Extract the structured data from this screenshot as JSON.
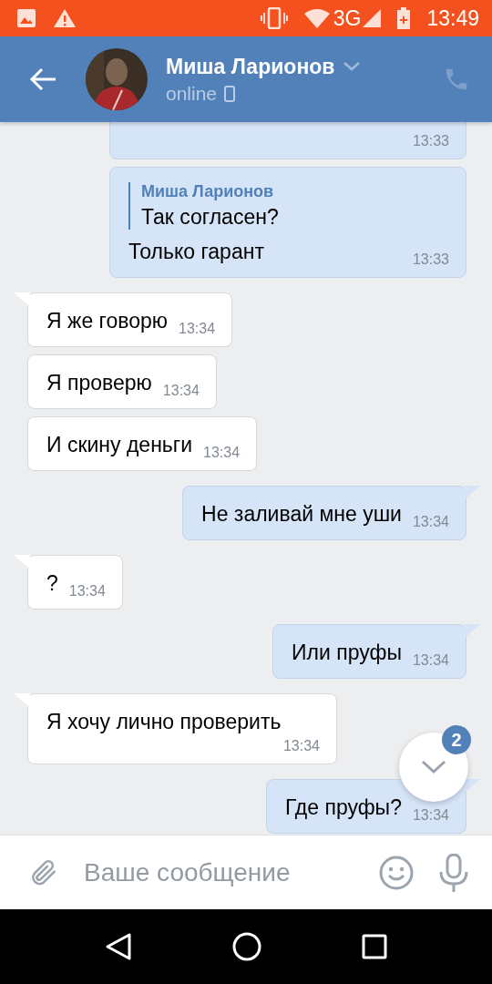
{
  "status_bar": {
    "network": "3G",
    "time": "13:49"
  },
  "header": {
    "name": "Миша Ларионов",
    "status": "online"
  },
  "messages": [
    {
      "outgoing": true,
      "tail": false,
      "time": "13:33"
    },
    {
      "outgoing": true,
      "tail": false,
      "quote": {
        "author": "Миша Ларионов",
        "text": "Так согласен?"
      },
      "text": "Только гарант",
      "time": "13:33"
    },
    {
      "outgoing": false,
      "tail": true,
      "text": "Я же говорю",
      "time": "13:34"
    },
    {
      "outgoing": false,
      "tail": false,
      "text": "Я проверю",
      "time": "13:34"
    },
    {
      "outgoing": false,
      "tail": false,
      "text": "И скину деньги",
      "time": "13:34"
    },
    {
      "outgoing": true,
      "tail": true,
      "text": "Не заливай мне уши",
      "time": "13:34"
    },
    {
      "outgoing": false,
      "tail": true,
      "text": "?",
      "time": "13:34"
    },
    {
      "outgoing": true,
      "tail": true,
      "text": "Или пруфы",
      "time": "13:34"
    },
    {
      "outgoing": false,
      "tail": true,
      "text": "Я хочу лично проверить",
      "time": "13:34"
    },
    {
      "outgoing": true,
      "tail": true,
      "text": "Где пруфы?",
      "time": "13:34"
    }
  ],
  "scroll_button": {
    "badge": "2"
  },
  "composer": {
    "placeholder": "Ваше сообщение"
  }
}
